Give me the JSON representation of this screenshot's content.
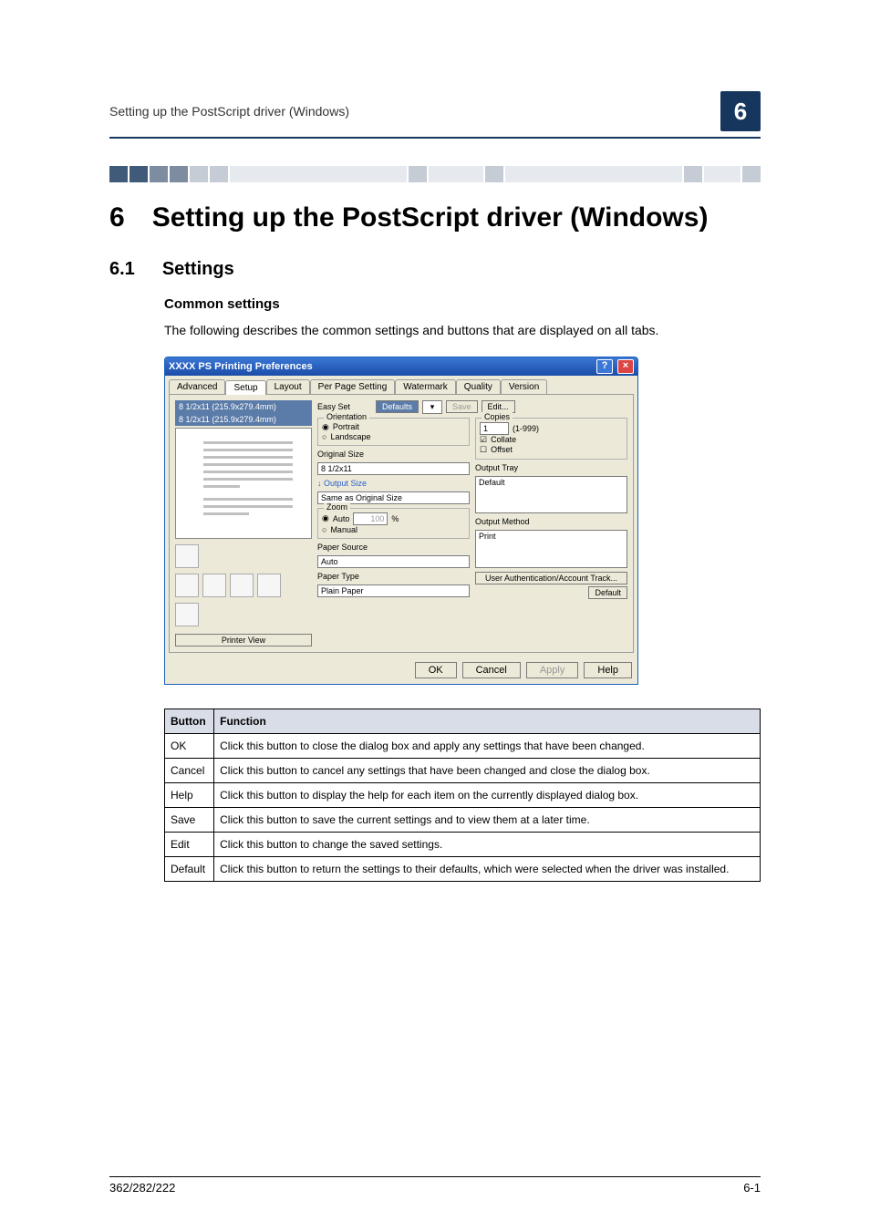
{
  "running_head": "Setting up the PostScript driver (Windows)",
  "chapter_badge": "6",
  "chapter_number": "6",
  "chapter_title": "Setting up the PostScript driver (Windows)",
  "section_number": "6.1",
  "section_title": "Settings",
  "subheading": "Common settings",
  "intro": "The following describes the common settings and buttons that are displayed on all tabs.",
  "dialog": {
    "title": "XXXX PS Printing Preferences",
    "close_icon": "×",
    "help_icon": "?",
    "tabs": [
      "Advanced",
      "Setup",
      "Layout",
      "Per Page Setting",
      "Watermark",
      "Quality",
      "Version"
    ],
    "active_tab": 1,
    "preview_line1": "8 1/2x11 (215.9x279.4mm)",
    "preview_line2": "8 1/2x11 (215.9x279.4mm)",
    "printer_view": "Printer View",
    "easy_set": "Easy Set",
    "defaults_btn": "Defaults",
    "save_btn": "Save",
    "edit_btn": "Edit...",
    "orientation_label": "Orientation",
    "portrait": "Portrait",
    "landscape": "Landscape",
    "original_size_label": "Original Size",
    "original_size": "8 1/2x11",
    "output_size_label": "Output Size",
    "output_size": "Same as Original Size",
    "zoom_label": "Zoom",
    "zoom_auto": "Auto",
    "zoom_manual": "Manual",
    "zoom_val": "100",
    "zoom_pct": "%",
    "paper_source_label": "Paper Source",
    "paper_source": "Auto",
    "paper_type_label": "Paper Type",
    "paper_type": "Plain Paper",
    "copies_label": "Copies",
    "copies_val": "1",
    "copies_range": "(1-999)",
    "collate": "Collate",
    "offset": "Offset",
    "output_tray_label": "Output Tray",
    "output_tray": "Default",
    "output_method_label": "Output Method",
    "output_method": "Print",
    "auth_btn": "User Authentication/Account Track...",
    "default_btn": "Default",
    "ok": "OK",
    "cancel": "Cancel",
    "apply": "Apply",
    "help": "Help"
  },
  "table": {
    "headers": [
      "Button",
      "Function"
    ],
    "rows": [
      [
        "OK",
        "Click this button to close the dialog box and apply any settings that have been changed."
      ],
      [
        "Cancel",
        "Click this button to cancel any settings that have been changed and close the dialog box."
      ],
      [
        "Help",
        "Click this button to display the help for each item on the currently displayed dialog box."
      ],
      [
        "Save",
        "Click this button to save the current settings and to view them at a later time."
      ],
      [
        "Edit",
        "Click this button to change the saved settings."
      ],
      [
        "Default",
        "Click this button to return the settings to their defaults, which were selected when the driver was installed."
      ]
    ]
  },
  "footer_left": "362/282/222",
  "footer_right": "6-1"
}
